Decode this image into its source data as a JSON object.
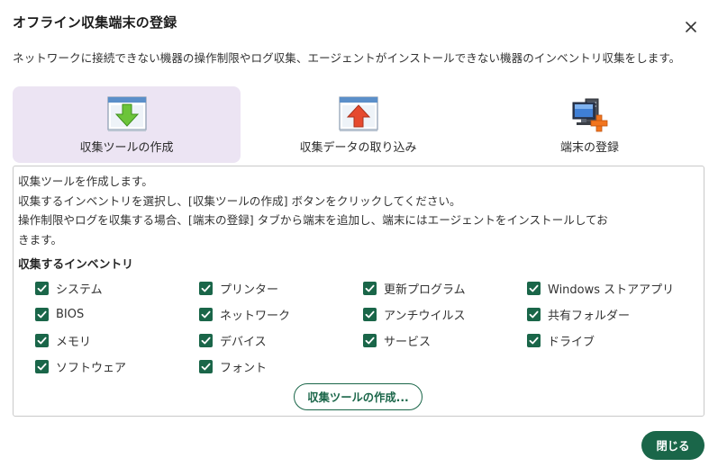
{
  "dialog": {
    "title": "オフライン収集端末の登録",
    "description": "ネットワークに接続できない機器の操作制限やログ収集、エージェントがインストールできない機器のインベントリ収集をします。"
  },
  "tabs": [
    {
      "label": "収集ツールの作成",
      "icon": "download-window-icon",
      "active": true
    },
    {
      "label": "収集データの取り込み",
      "icon": "upload-window-icon",
      "active": false
    },
    {
      "label": "端末の登録",
      "icon": "computer-add-icon",
      "active": false
    }
  ],
  "panel": {
    "lines": [
      "収集ツールを作成します。",
      "収集するインベントリを選択し、[収集ツールの作成] ボタンをクリックしてください。",
      "操作制限やログを収集する場合、[端末の登録] タブから端末を追加し、端末にはエージェントをインストールしてお",
      "きます。"
    ],
    "section_heading": "収集するインベントリ",
    "inventory": [
      {
        "label": "システム",
        "checked": true
      },
      {
        "label": "プリンター",
        "checked": true
      },
      {
        "label": "更新プログラム",
        "checked": true
      },
      {
        "label": "Windows ストアアプリ",
        "checked": true
      },
      {
        "label": "BIOS",
        "checked": true
      },
      {
        "label": "ネットワーク",
        "checked": true
      },
      {
        "label": "アンチウイルス",
        "checked": true
      },
      {
        "label": "共有フォルダー",
        "checked": true
      },
      {
        "label": "メモリ",
        "checked": true
      },
      {
        "label": "デバイス",
        "checked": true
      },
      {
        "label": "サービス",
        "checked": true
      },
      {
        "label": "ドライブ",
        "checked": true
      },
      {
        "label": "ソフトウェア",
        "checked": true
      },
      {
        "label": "フォント",
        "checked": true
      }
    ],
    "create_button_label": "収集ツールの作成..."
  },
  "footer": {
    "close_button_label": "閉じる"
  },
  "colors": {
    "accent": "#1a6649",
    "active_tab_bg": "#ece4f3",
    "download_arrow": "#6cc43a",
    "upload_arrow": "#e64a2e"
  }
}
